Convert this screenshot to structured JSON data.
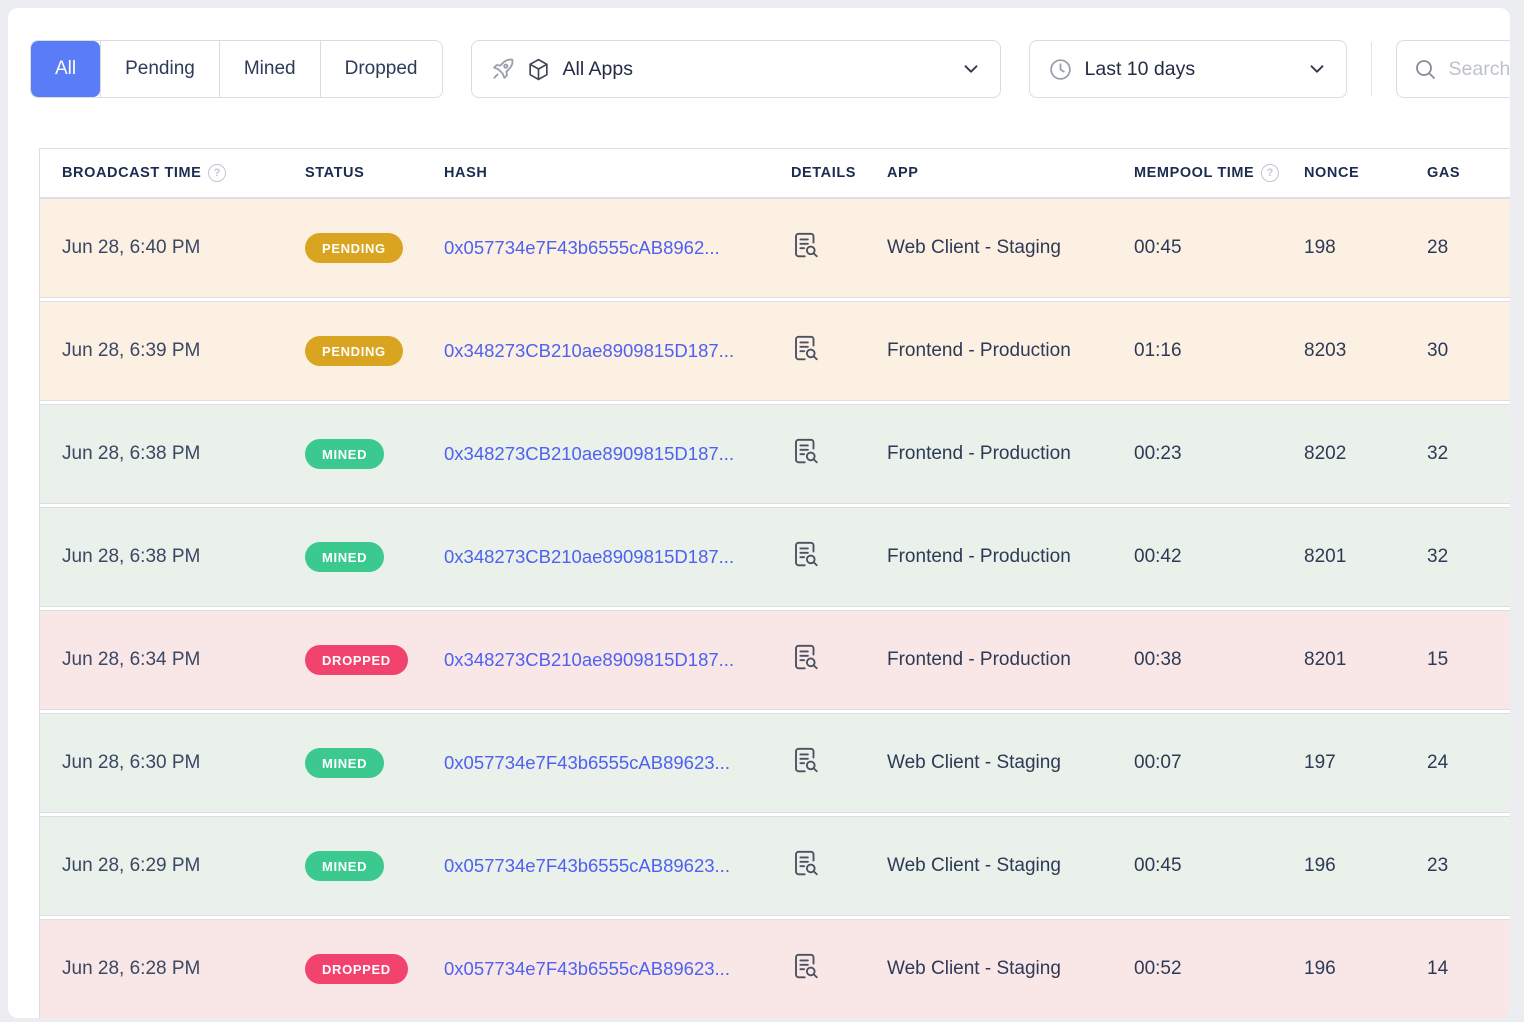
{
  "filters": {
    "tabs": [
      {
        "label": "All",
        "active": true
      },
      {
        "label": "Pending",
        "active": false
      },
      {
        "label": "Mined",
        "active": false
      },
      {
        "label": "Dropped",
        "active": false
      }
    ],
    "app_filter": {
      "value": "All Apps"
    },
    "time_filter": {
      "value": "Last 10 days"
    },
    "search": {
      "placeholder": "Search"
    }
  },
  "icons": {
    "help": "?"
  },
  "colors": {
    "accent_blue": "#5b7cf7",
    "pending_badge": "#d9a41f",
    "mined_badge": "#3bc98f",
    "dropped_badge": "#f2426e",
    "pending_row_bg": "#fcf0e3",
    "mined_row_bg": "#e9f1ea",
    "dropped_row_bg": "#f9e7e7",
    "hash_link": "#4e61f0"
  },
  "table": {
    "columns": [
      "BROADCAST TIME",
      "STATUS",
      "HASH",
      "DETAILS",
      "APP",
      "MEMPOOL TIME",
      "NONCE",
      "GAS"
    ],
    "rows": [
      {
        "broadcast_time": "Jun 28, 6:40 PM",
        "status": "PENDING",
        "hash": "0x057734e7F43b6555cAB8962...",
        "app": "Web Client - Staging",
        "mempool_time": "00:45",
        "nonce": "198",
        "gas": "28"
      },
      {
        "broadcast_time": "Jun 28, 6:39 PM",
        "status": "PENDING",
        "hash": "0x348273CB210ae8909815D187...",
        "app": "Frontend - Production",
        "mempool_time": "01:16",
        "nonce": "8203",
        "gas": "30"
      },
      {
        "broadcast_time": "Jun 28, 6:38 PM",
        "status": "MINED",
        "hash": "0x348273CB210ae8909815D187...",
        "app": "Frontend - Production",
        "mempool_time": "00:23",
        "nonce": "8202",
        "gas": "32"
      },
      {
        "broadcast_time": "Jun 28, 6:38 PM",
        "status": "MINED",
        "hash": "0x348273CB210ae8909815D187...",
        "app": "Frontend - Production",
        "mempool_time": "00:42",
        "nonce": "8201",
        "gas": "32"
      },
      {
        "broadcast_time": "Jun 28, 6:34 PM",
        "status": "DROPPED",
        "hash": "0x348273CB210ae8909815D187...",
        "app": "Frontend - Production",
        "mempool_time": "00:38",
        "nonce": "8201",
        "gas": "15"
      },
      {
        "broadcast_time": "Jun 28, 6:30 PM",
        "status": "MINED",
        "hash": "0x057734e7F43b6555cAB89623...",
        "app": "Web Client - Staging",
        "mempool_time": "00:07",
        "nonce": "197",
        "gas": "24"
      },
      {
        "broadcast_time": "Jun 28, 6:29 PM",
        "status": "MINED",
        "hash": "0x057734e7F43b6555cAB89623...",
        "app": "Web Client - Staging",
        "mempool_time": "00:45",
        "nonce": "196",
        "gas": "23"
      },
      {
        "broadcast_time": "Jun 28, 6:28 PM",
        "status": "DROPPED",
        "hash": "0x057734e7F43b6555cAB89623...",
        "app": "Web Client - Staging",
        "mempool_time": "00:52",
        "nonce": "196",
        "gas": "14"
      }
    ]
  }
}
